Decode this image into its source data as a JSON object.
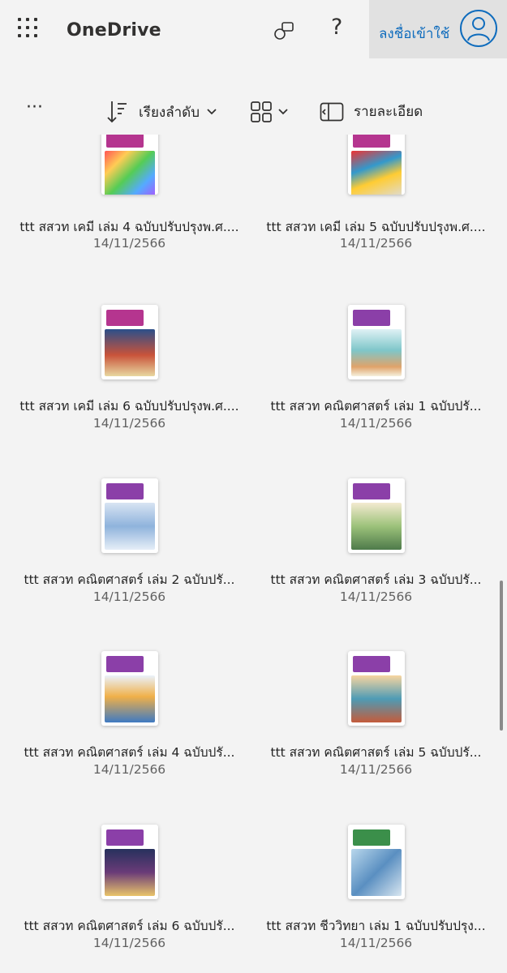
{
  "header": {
    "app_title": "OneDrive",
    "signin_label": "ลงชื่อเข้าใช้",
    "help_glyph": "?",
    "icons": [
      "app-launcher-icon",
      "feedback-icon",
      "help-icon",
      "avatar-icon"
    ]
  },
  "toolbar": {
    "more_glyph": "···",
    "sort_label": "เรียงลำดับ",
    "details_label": "รายละเอียด"
  },
  "files": [
    {
      "name": "ttt สสวท เคมี เล่ม 4 ฉบับปรับปรุงพ.ศ....",
      "date": "14/11/2566",
      "band": "#b5358f",
      "art": "linear-gradient(135deg,#f55 0%,#fc5 25%,#5c5 50%,#5af 75%,#a5f 100%)"
    },
    {
      "name": "ttt สสวท เคมี เล่ม 5 ฉบับปรับปรุงพ.ศ....",
      "date": "14/11/2566",
      "band": "#b5358f",
      "art": "linear-gradient(160deg,#e33 0%,#39c 35%,#fc3 60%,#ddd 100%)"
    },
    {
      "name": "ttt สสวท เคมี เล่ม 6 ฉบับปรับปรุงพ.ศ....",
      "date": "14/11/2566",
      "band": "#b5358f",
      "art": "linear-gradient(180deg,#2b4f8a 0%,#c9533a 55%,#e8d7a0 100%)"
    },
    {
      "name": "ttt สสวท คณิตศาสตร์ เล่ม 1 ฉบับปรั...",
      "date": "14/11/2566",
      "band": "#8b3fa8",
      "art": "linear-gradient(180deg,#dff1f5 0%,#7ec6c9 45%,#e0a36a 80%,#f5f0dd 100%)"
    },
    {
      "name": "ttt สสวท คณิตศาสตร์ เล่ม 2 ฉบับปรั...",
      "date": "14/11/2566",
      "band": "#8b3fa8",
      "art": "linear-gradient(180deg,#d8e4f3 0%,#8fb3dc 50%,#e6eef7 100%)"
    },
    {
      "name": "ttt สสวท คณิตศาสตร์ เล่ม 3 ฉบับปรั...",
      "date": "14/11/2566",
      "band": "#8b3fa8",
      "art": "linear-gradient(180deg,#f3ead0 0%,#9cc27a 50%,#4e7a4b 100%)"
    },
    {
      "name": "ttt สสวท คณิตศาสตร์ เล่ม 4 ฉบับปรั...",
      "date": "14/11/2566",
      "band": "#8b3fa8",
      "art": "linear-gradient(180deg,#eaf2fb 0%,#f0b049 45%,#3f7ac2 100%)"
    },
    {
      "name": "ttt สสวท คณิตศาสตร์ เล่ม 5 ฉบับปรั...",
      "date": "14/11/2566",
      "band": "#8b3fa8",
      "art": "linear-gradient(180deg,#f7d5a0 0%,#4e9bb5 50%,#c45b3b 100%)"
    },
    {
      "name": "ttt สสวท คณิตศาสตร์ เล่ม 6 ฉบับปรั...",
      "date": "14/11/2566",
      "band": "#8b3fa8",
      "art": "linear-gradient(180deg,#27315d 0%,#6a3b78 50%,#e9c46a 100%)"
    },
    {
      "name": "ttt สสวท ชีววิทยา เล่ม 1 ฉบับปรับปรุง...",
      "date": "14/11/2566",
      "band": "#3b8f4a",
      "art": "linear-gradient(135deg,#b9d7ec 0%,#5a8fc1 50%,#d8e6f0 100%)"
    }
  ]
}
